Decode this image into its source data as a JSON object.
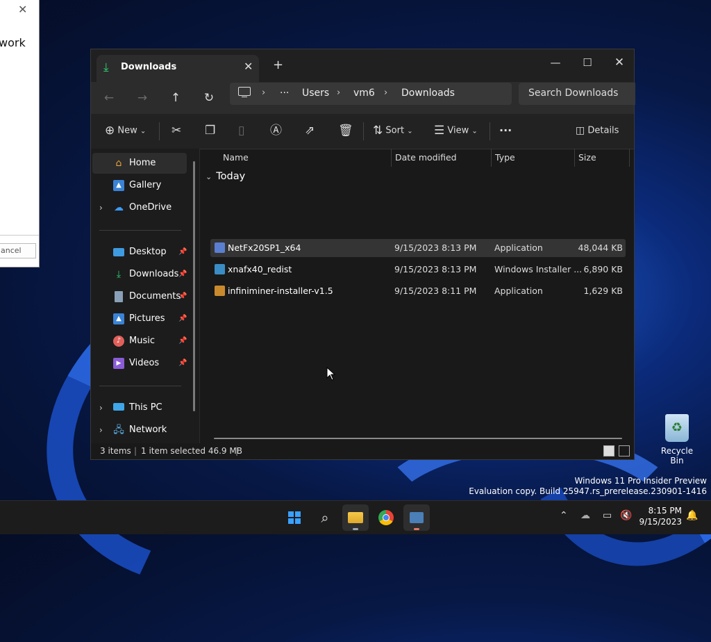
{
  "background_window": {
    "close": "✕",
    "text_fragment": "work",
    "button_fragment": "ancel"
  },
  "explorer": {
    "tab_title": "Downloads",
    "tab_close": "✕",
    "new_tab": "+",
    "window_controls": {
      "minimize": "—",
      "maximize": "☐",
      "close": "✕"
    },
    "nav": {
      "back": "←",
      "forward": "→",
      "up": "↑",
      "refresh": "↻"
    },
    "breadcrumb": {
      "more": "···",
      "items": [
        "Users",
        "vm6",
        "Downloads"
      ],
      "sep": "›"
    },
    "search_placeholder": "Search Downloads",
    "commands": {
      "new": "New",
      "sort": "Sort",
      "view": "View",
      "more": "···",
      "details": "Details"
    },
    "nav_pane": {
      "home": "Home",
      "gallery": "Gallery",
      "onedrive": "OneDrive",
      "quick_access": [
        "Desktop",
        "Downloads",
        "Documents",
        "Pictures",
        "Music",
        "Videos"
      ],
      "this_pc": "This PC",
      "network": "Network"
    },
    "columns": {
      "name": "Name",
      "date_modified": "Date modified",
      "type": "Type",
      "size": "Size"
    },
    "group_label": "Today",
    "files": [
      {
        "name": "NetFx20SP1_x64",
        "date": "9/15/2023 8:13 PM",
        "type": "Application",
        "size": "48,044 KB",
        "icon_color": "#5b7fd0"
      },
      {
        "name": "xnafx40_redist",
        "date": "9/15/2023 8:13 PM",
        "type": "Windows Installer ...",
        "size": "6,890 KB",
        "icon_color": "#3a8dc4"
      },
      {
        "name": "infiniminer-installer-v1.5",
        "date": "9/15/2023 8:11 PM",
        "type": "Application",
        "size": "1,629 KB",
        "icon_color": "#c98a2e"
      }
    ],
    "status": {
      "count": "3 items",
      "selection": "1 item selected  46.9 MB"
    }
  },
  "desktop": {
    "recycle_bin": "Recycle Bin",
    "watermark_line1": "Windows 11 Pro Insider Preview",
    "watermark_line2": "Evaluation copy. Build 25947.rs_prerelease.230901-1416"
  },
  "taskbar": {
    "time": "8:15 PM",
    "date": "9/15/2023"
  }
}
